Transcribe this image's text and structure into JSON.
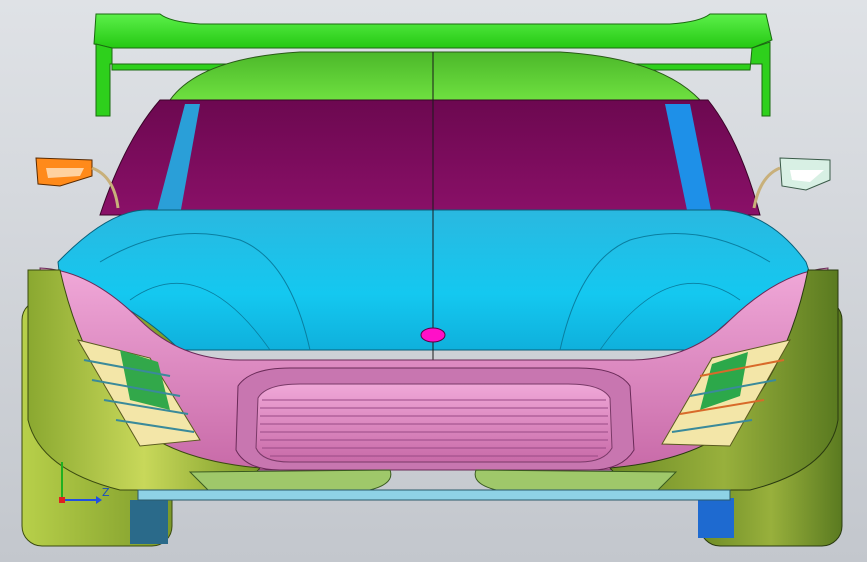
{
  "viewport": {
    "view": "front",
    "background_color": "#d4d7dc"
  },
  "model": {
    "colors": {
      "wing": "#33dd22",
      "roof": "#55d42a",
      "windshield": "#7a0a58",
      "a_pillar": "#2a9fd8",
      "hood": "#1fc4e8",
      "fascia": "#e68ec8",
      "grille": "#e9a3d2",
      "fender": "#a9bf3a",
      "tire": "#98b03c",
      "mirror_left": "#ff8a1a",
      "mirror_right": "#d8f0e4",
      "emblem": "#ff10c8",
      "splitter": "#8ed2e6",
      "lip": "#9fc86a"
    }
  },
  "axis_triad": {
    "x_color": "#e02020",
    "y_color": "#20b020",
    "z_color": "#2050e0",
    "z_label": "Z"
  }
}
